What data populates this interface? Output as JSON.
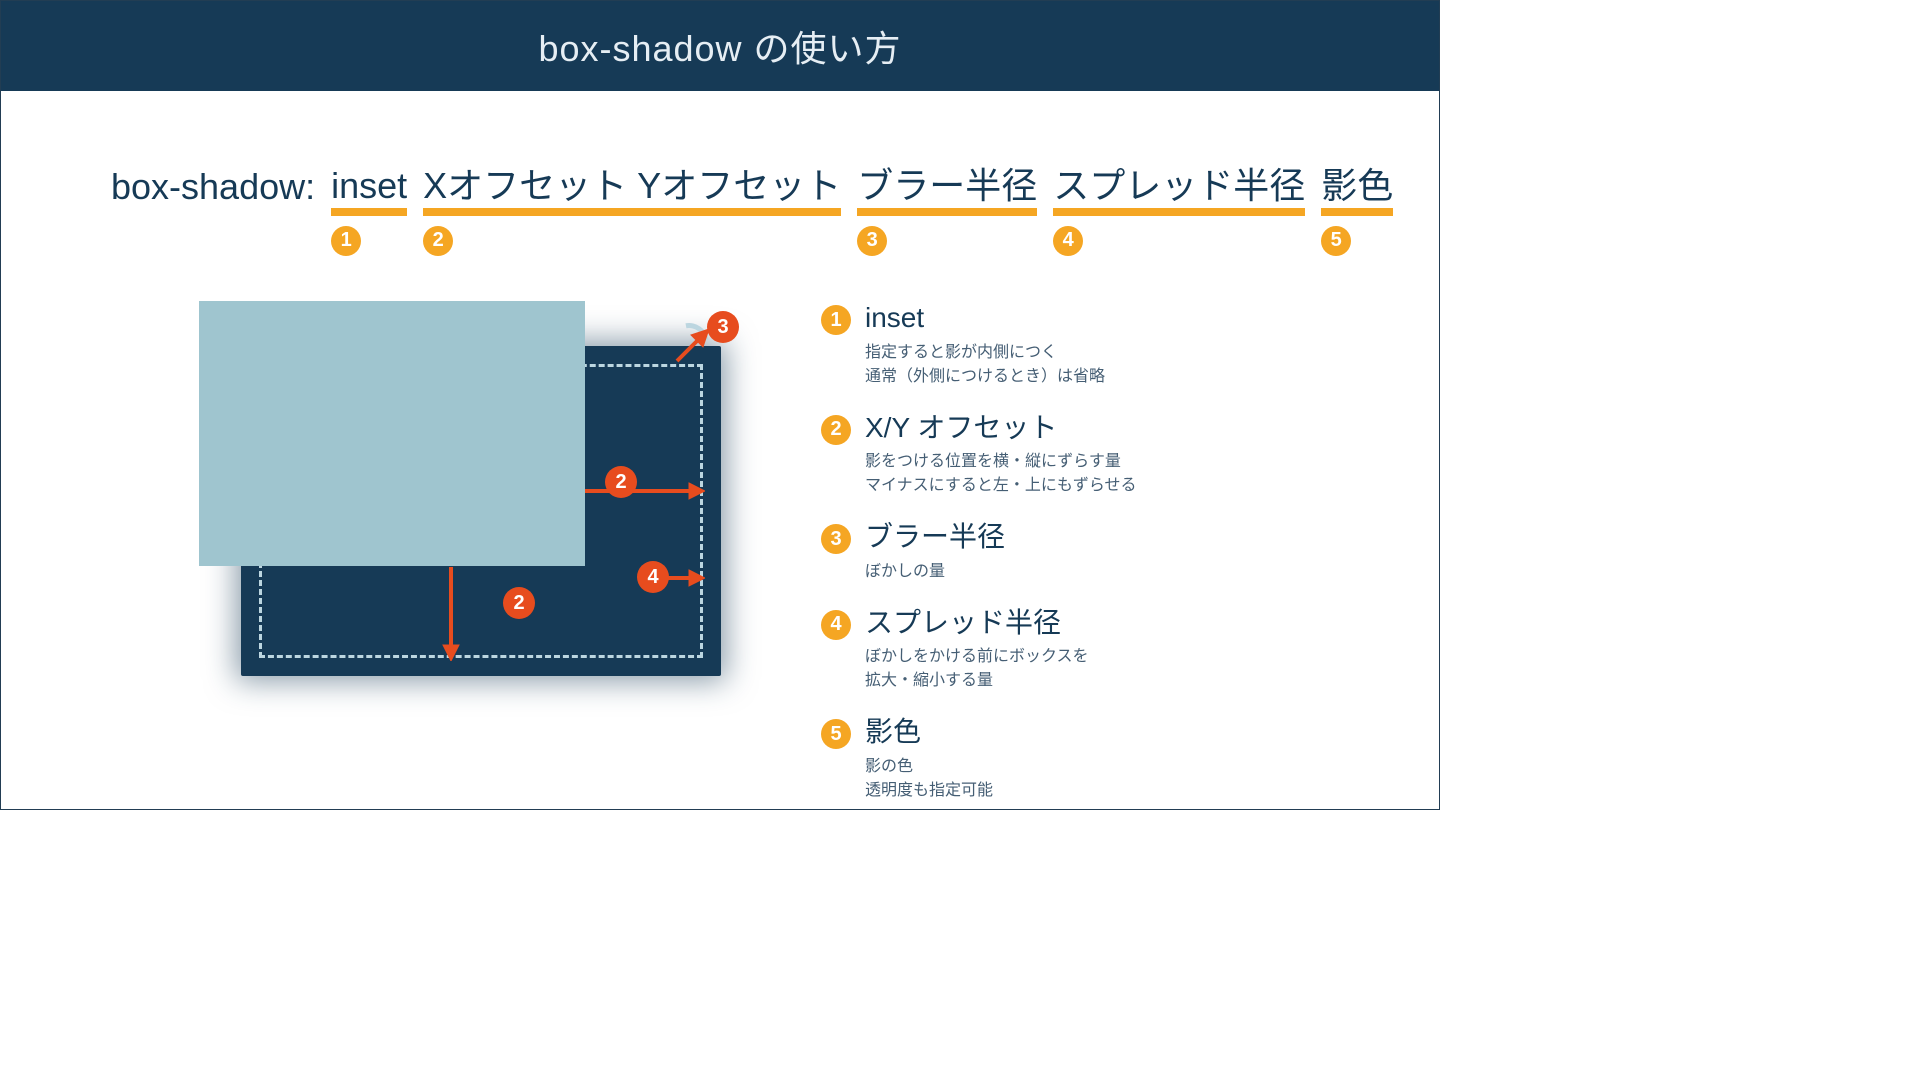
{
  "header": {
    "title": "box-shadow の使い方"
  },
  "syntax": {
    "prefix": "box-shadow:",
    "items": [
      {
        "word": "inset",
        "num": "1"
      },
      {
        "word": "Xオフセット  Yオフセット",
        "num": "2"
      },
      {
        "word": "ブラー半径",
        "num": "3"
      },
      {
        "word": "スプレッド半径",
        "num": "4"
      },
      {
        "word": "影色",
        "num": "5"
      }
    ]
  },
  "diagram": {
    "labels": {
      "offset_h": "2",
      "offset_v": "2",
      "blur": "3",
      "spread": "4"
    }
  },
  "legend": [
    {
      "num": "1",
      "title": "inset",
      "desc": "指定すると影が内側につく\n通常（外側につけるとき）は省略"
    },
    {
      "num": "2",
      "title": "X/Y オフセット",
      "desc": "影をつける位置を横・縦にずらす量\nマイナスにすると左・上にもずらせる"
    },
    {
      "num": "3",
      "title": "ブラー半径",
      "desc": "ぼかしの量"
    },
    {
      "num": "4",
      "title": "スプレッド半径",
      "desc": "ぼかしをかける前にボックスを\n拡大・縮小する量"
    },
    {
      "num": "5",
      "title": "影色",
      "desc": "影の色\n透明度も指定可能"
    }
  ]
}
